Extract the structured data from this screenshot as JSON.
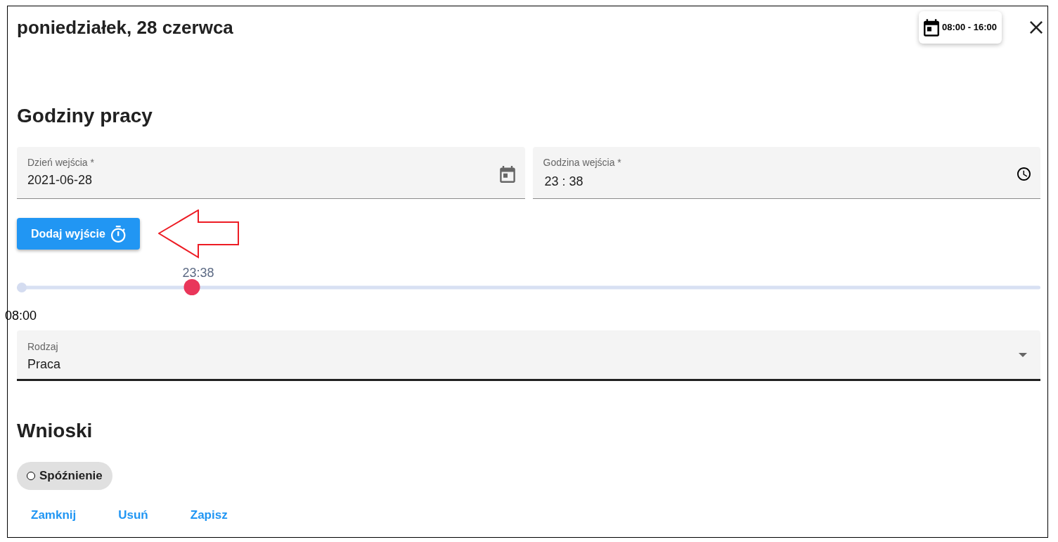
{
  "dialog": {
    "title": "poniedziałek, 28 czerwca",
    "schedule_chip": "08:00 - 16:00"
  },
  "work_hours": {
    "heading": "Godziny pracy",
    "fields": [
      {
        "kind": "date",
        "label": "Dzień wejścia *",
        "value": "2021-06-28"
      },
      {
        "kind": "time",
        "label": "Godzina wejścia *",
        "value": "23 : 38"
      }
    ],
    "add_exit_button": "Dodaj wyjście",
    "slider": {
      "value_label": "23:38",
      "level": 0.171,
      "start_label": "08:00"
    },
    "type_select": {
      "label": "Rodzaj",
      "value": "Praca"
    }
  },
  "requests": {
    "heading": "Wnioski",
    "chips": [
      {
        "label": "Spóźnienie",
        "selected": false
      }
    ]
  },
  "actions": [
    "Zamknij",
    "Usuń",
    "Zapisz"
  ]
}
